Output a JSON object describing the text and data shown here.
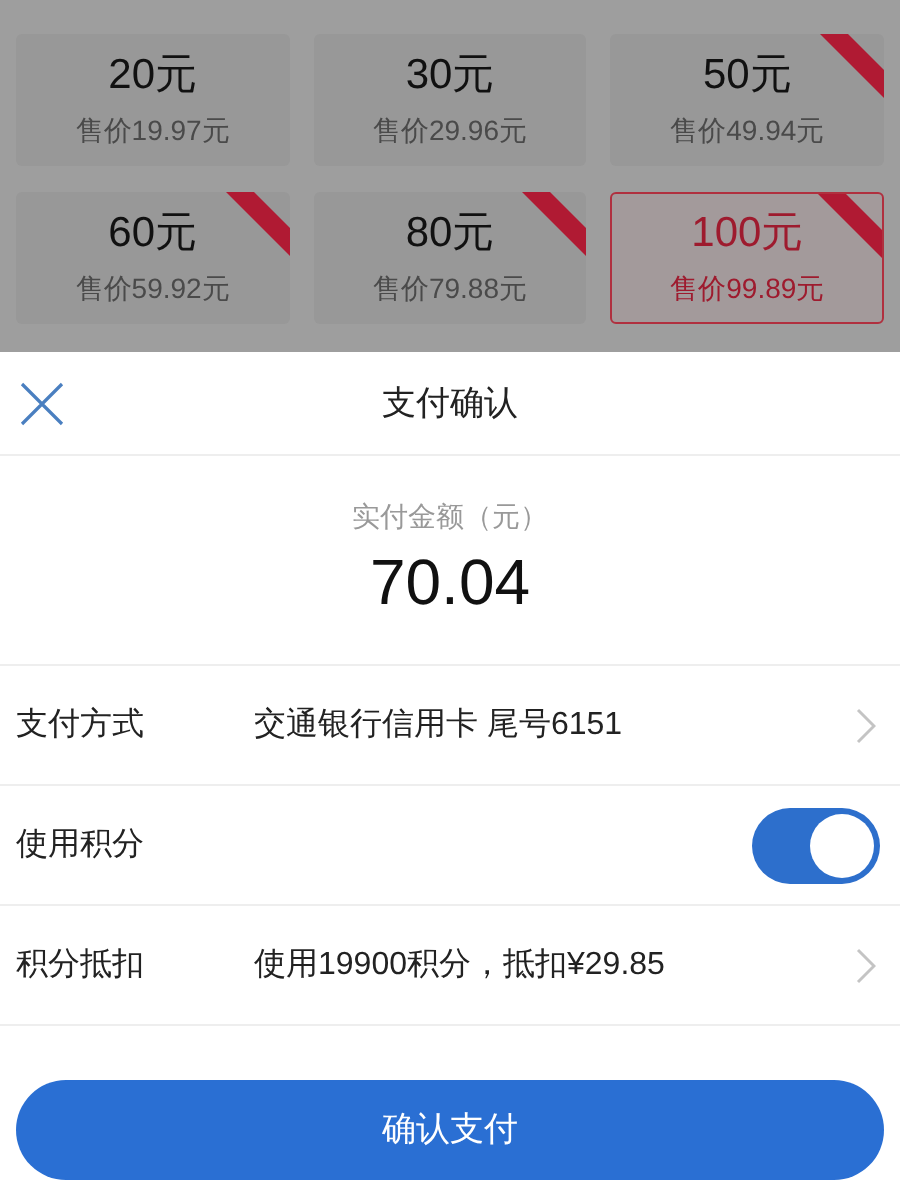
{
  "packages": [
    {
      "amount": "20元",
      "price": "售价19.97元",
      "badge": false,
      "selected": false
    },
    {
      "amount": "30元",
      "price": "售价29.96元",
      "badge": false,
      "selected": false
    },
    {
      "amount": "50元",
      "price": "售价49.94元",
      "badge": true,
      "selected": false
    },
    {
      "amount": "60元",
      "price": "售价59.92元",
      "badge": true,
      "selected": false
    },
    {
      "amount": "80元",
      "price": "售价79.88元",
      "badge": true,
      "selected": false
    },
    {
      "amount": "100元",
      "price": "售价99.89元",
      "badge": true,
      "selected": true
    }
  ],
  "sheet": {
    "title": "支付确认",
    "amount_label": "实付金额（元）",
    "amount": "70.04",
    "rows": [
      {
        "kind": "link",
        "label": "支付方式",
        "value": "交通银行信用卡 尾号6151"
      },
      {
        "kind": "toggle",
        "label": "使用积分",
        "on": true
      },
      {
        "kind": "link",
        "label": "积分抵扣",
        "value": "使用19900积分，抵扣¥29.85"
      }
    ],
    "confirm_button": "确认支付"
  }
}
